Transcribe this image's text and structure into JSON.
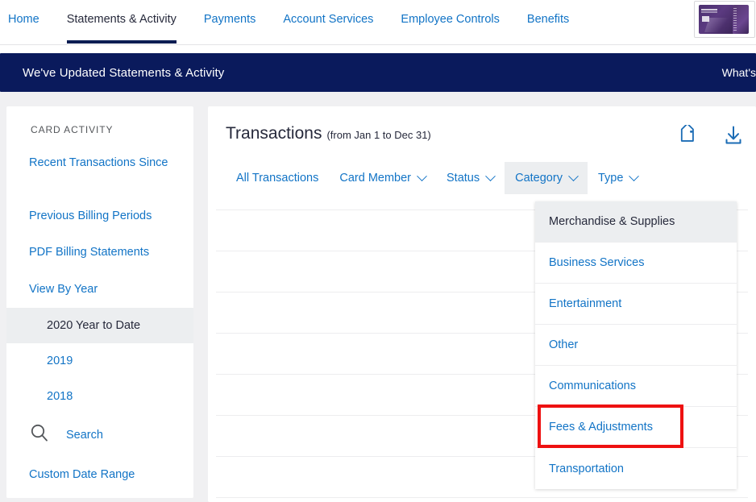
{
  "topnav": {
    "items": [
      {
        "label": "Home",
        "active": false
      },
      {
        "label": "Statements & Activity",
        "active": true
      },
      {
        "label": "Payments",
        "active": false
      },
      {
        "label": "Account Services",
        "active": false
      },
      {
        "label": "Employee Controls",
        "active": false
      },
      {
        "label": "Benefits",
        "active": false
      }
    ],
    "card_thumb_name": "credit-card-thumbnail"
  },
  "banner": {
    "text": "We've Updated Statements & Activity",
    "link": "What's",
    "bg_color": "#0a1a5c"
  },
  "sidebar": {
    "heading": "CARD ACTIVITY",
    "links": [
      {
        "label": "Recent Transactions Since"
      },
      {
        "label": "Previous Billing Periods"
      },
      {
        "label": "PDF Billing Statements"
      },
      {
        "label": "View By Year"
      }
    ],
    "years": [
      {
        "label": "2020 Year to Date",
        "selected": true
      },
      {
        "label": "2019",
        "selected": false
      },
      {
        "label": "2018",
        "selected": false
      }
    ],
    "search_label": "Search",
    "search_icon": "magnifier-icon",
    "custom_range_label": "Custom Date Range"
  },
  "main": {
    "title": "Transactions",
    "title_sub": "(from Jan 1 to Dec 31)",
    "icons": [
      {
        "name": "tag-icon"
      },
      {
        "name": "download-icon"
      }
    ],
    "filters": [
      {
        "label": "All Transactions",
        "caret": false,
        "active": false
      },
      {
        "label": "Card Member",
        "caret": true,
        "active": false
      },
      {
        "label": "Status",
        "caret": true,
        "active": false
      },
      {
        "label": "Category",
        "caret": true,
        "active": true
      },
      {
        "label": "Type",
        "caret": true,
        "active": false
      }
    ]
  },
  "dropdown": {
    "name": "category-dropdown",
    "items": [
      {
        "label": "Merchandise & Supplies",
        "selected": true
      },
      {
        "label": "Business Services",
        "selected": false
      },
      {
        "label": "Entertainment",
        "selected": false
      },
      {
        "label": "Other",
        "selected": false
      },
      {
        "label": "Communications",
        "selected": false
      },
      {
        "label": "Fees & Adjustments",
        "selected": false
      },
      {
        "label": "Transportation",
        "selected": false
      }
    ],
    "highlighted_item": "Fees & Adjustments",
    "highlight_color": "#ee1111"
  },
  "colors": {
    "link_blue": "#1274c6",
    "navy": "#0a1a5c",
    "text_dark": "#26293b",
    "selected_gray": "#eceef0",
    "page_bg": "#f0f0f2"
  }
}
